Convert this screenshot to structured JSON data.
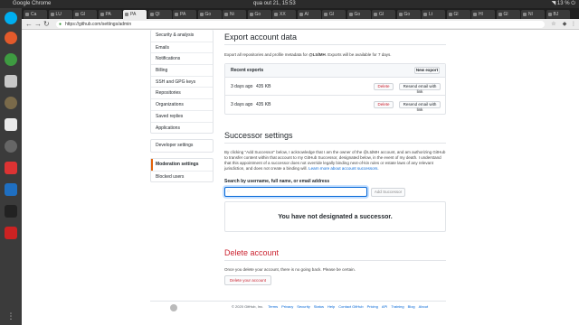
{
  "os": {
    "app_name": "Google Chrome",
    "clock": "qua out 21, 15:53",
    "battery": "13 %"
  },
  "browser": {
    "tabs": [
      "Ca",
      "LU",
      "Gl",
      "PA",
      "PA",
      "Ql",
      "PA",
      "Go",
      "Ni",
      "Go",
      "XX",
      "Al",
      "Gl",
      "Go",
      "Gl",
      "Go",
      "Lt",
      "Gl",
      "Hl",
      "Gl",
      "Nl",
      "BJ"
    ],
    "url": "https://github.com/settings/admin"
  },
  "sidebar": {
    "group1": [
      "Security & analysis",
      "Emails",
      "Notifications",
      "Billing",
      "SSH and GPG keys",
      "Repositories",
      "Organizations",
      "Saved replies",
      "Applications"
    ],
    "group2": [
      "Developer settings"
    ],
    "group3": [
      "Moderation settings",
      "Blocked users"
    ]
  },
  "export": {
    "title": "Export account data",
    "desc_prefix": "Export all repositories and profile metadata for ",
    "user": "@LtdMH",
    "desc_suffix": ". Exports will be available for 7 days.",
    "recent_label": "Recent exports",
    "new_button": "New export",
    "rows": [
      {
        "when": "3 days ago",
        "size": "435 KB",
        "delete": "Delete",
        "resend": "Resend email with link"
      },
      {
        "when": "3 days ago",
        "size": "435 KB",
        "delete": "Delete",
        "resend": "Resend email with link"
      }
    ]
  },
  "successor": {
    "title": "Successor settings",
    "desc": "By clicking \"Add Successor\" below, I acknowledge that I am the owner of the @LtdMH account, and am authorizing GitHub to transfer content within that account to my GitHub Successor, designated below, in the event of my death. I understand that this appointment of a successor does not override legally binding next-of-kin rules or estate laws of any relevant jurisdiction, and does not create a binding will.",
    "learn_more": "Learn more about account successors.",
    "search_label": "Search by username, full name, or email address",
    "search_placeholder": "",
    "add_button": "Add Successor",
    "empty_text": "You have not designated a successor."
  },
  "delete": {
    "title": "Delete account",
    "desc": "Once you delete your account, there is no going back. Please be certain.",
    "button": "Delete your account"
  },
  "footer": {
    "copyright": "© 2020 GitHub, Inc.",
    "links": [
      "Terms",
      "Privacy",
      "Security",
      "Status",
      "Help",
      "Contact GitHub",
      "Pricing",
      "API",
      "Training",
      "Blog",
      "About"
    ]
  }
}
